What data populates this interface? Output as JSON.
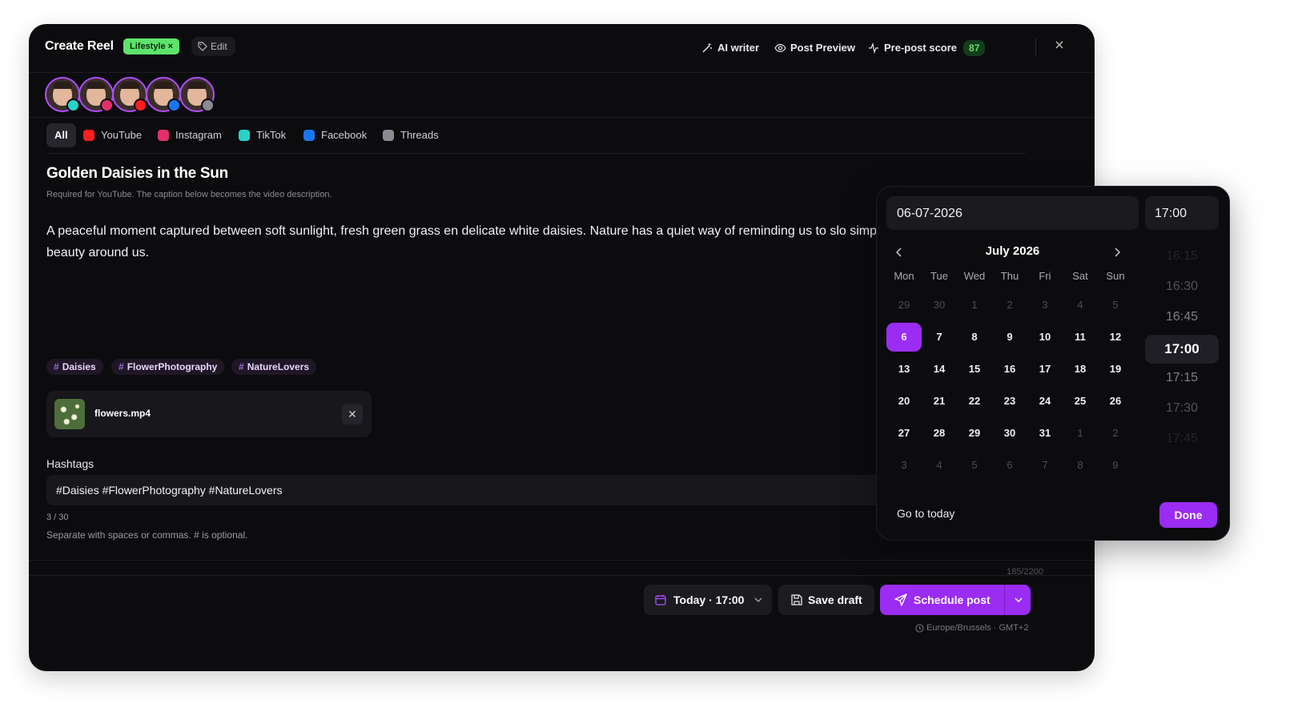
{
  "header": {
    "title": "Create Reel",
    "category": "Lifestyle ×",
    "edit": "Edit",
    "ai_writer": "AI writer",
    "post_preview": "Post Preview",
    "prepost_score_label": "Pre-post score",
    "prepost_score": "87"
  },
  "platforms": {
    "tabs": [
      {
        "label": "All"
      },
      {
        "label": "YouTube",
        "color": "#ff1e1e"
      },
      {
        "label": "Instagram",
        "color": "#e1306c"
      },
      {
        "label": "TikTok",
        "color": "#25d3c9"
      },
      {
        "label": "Facebook",
        "color": "#1877f2"
      },
      {
        "label": "Threads",
        "color": "#8a8a93"
      }
    ]
  },
  "post": {
    "title": "Golden Daisies in the Sun",
    "note": "Required for YouTube. The caption below becomes the video description.",
    "caption": "A peaceful moment captured between soft sunlight, fresh green grass en delicate white daisies. Nature has a quiet way of reminding us to slo simple beauty around us."
  },
  "tags": [
    "Daisies",
    "FlowerPhotography",
    "NatureLovers"
  ],
  "file": {
    "name": "flowers.mp4"
  },
  "hashtags": {
    "label": "Hashtags",
    "value": "#Daisies #FlowerPhotography #NatureLovers",
    "count": "3 / 30",
    "help": "Separate with spaces or commas. # is optional."
  },
  "char_count": "185/2200",
  "footer": {
    "date_button": "Today · 17:00",
    "save_draft": "Save draft",
    "schedule": "Schedule post",
    "timezone": "Europe/Brussels · GMT+2"
  },
  "datepicker": {
    "date_value": "06-07-2026",
    "time_value": "17:00",
    "month": "July 2026",
    "weekdays": [
      "Mon",
      "Tue",
      "Wed",
      "Thu",
      "Fri",
      "Sat",
      "Sun"
    ],
    "weeks": [
      [
        "29",
        "30",
        "1",
        "2",
        "3",
        "4",
        "5"
      ],
      [
        "6",
        "7",
        "8",
        "9",
        "10",
        "11",
        "12"
      ],
      [
        "13",
        "14",
        "15",
        "16",
        "17",
        "18",
        "19"
      ],
      [
        "20",
        "21",
        "22",
        "23",
        "24",
        "25",
        "26"
      ],
      [
        "27",
        "28",
        "29",
        "30",
        "31",
        "1",
        "2"
      ],
      [
        "3",
        "4",
        "5",
        "6",
        "7",
        "8",
        "9"
      ]
    ],
    "muted": [
      [
        0,
        0
      ],
      [
        0,
        1
      ],
      [
        0,
        2
      ],
      [
        0,
        3
      ],
      [
        0,
        4
      ],
      [
        0,
        5
      ],
      [
        0,
        6
      ],
      [
        4,
        5
      ],
      [
        4,
        6
      ],
      [
        5,
        0
      ],
      [
        5,
        1
      ],
      [
        5,
        2
      ],
      [
        5,
        3
      ],
      [
        5,
        4
      ],
      [
        5,
        5
      ],
      [
        5,
        6
      ]
    ],
    "selected": [
      1,
      0
    ],
    "times": [
      "16:15",
      "16:30",
      "16:45",
      "17:00",
      "17:15",
      "17:30",
      "17:45"
    ],
    "selected_time_index": 3,
    "go_to_today": "Go to today",
    "done": "Done"
  },
  "colors": {
    "accent": "#9b2cf3",
    "green": "#5ee36a",
    "background": "#0c0c0f"
  }
}
